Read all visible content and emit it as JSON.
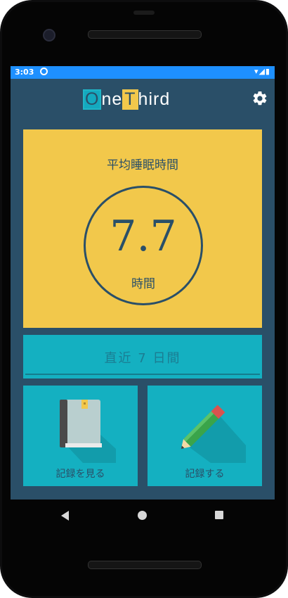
{
  "status_bar": {
    "time": "3:03",
    "sync_icon": "sync-icon",
    "right_icons": "▾◢▮"
  },
  "app_bar": {
    "logo_o": "O",
    "logo_ne": "ne",
    "logo_t": "T",
    "logo_hird": "hird",
    "settings_icon": "gear-icon"
  },
  "average_card": {
    "title": "平均睡眠時間",
    "value": "7.7",
    "unit": "時間"
  },
  "period_card": {
    "label": "直近 7 日間"
  },
  "actions": [
    {
      "label": "記録を見る",
      "icon": "book-icon"
    },
    {
      "label": "記録する",
      "icon": "pencil-icon"
    }
  ],
  "nav_bar": {
    "back_icon": "back-icon",
    "home_icon": "home-icon",
    "recent_icon": "recent-apps-icon"
  },
  "colors": {
    "background": "#2a4f68",
    "accent_yellow": "#f2c84b",
    "accent_cyan": "#14b0c1",
    "status_bar": "#1e90ff"
  }
}
